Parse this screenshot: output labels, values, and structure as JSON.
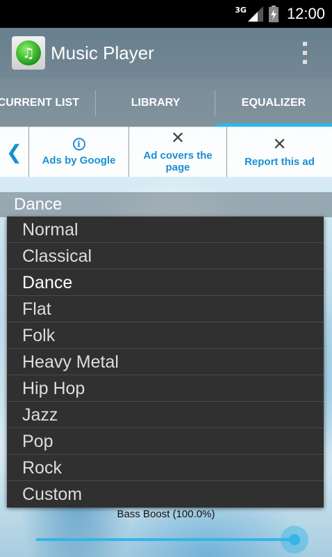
{
  "status_bar": {
    "network": "3G",
    "time": "12:00"
  },
  "action_bar": {
    "title": "Music Player",
    "icon": "music-note-icon"
  },
  "tabs": [
    {
      "label": "CURRENT LIST",
      "selected": false
    },
    {
      "label": "LIBRARY",
      "selected": false
    },
    {
      "label": "EQUALIZER",
      "selected": true
    }
  ],
  "ad_bar": {
    "ads_by_google": "Ads by Google",
    "ad_covers_line1": "Ad covers the",
    "ad_covers_line2": "page",
    "report_ad": "Report this ad"
  },
  "equalizer": {
    "current_preset": "Dance",
    "presets": [
      "Normal",
      "Classical",
      "Dance",
      "Flat",
      "Folk",
      "Heavy Metal",
      "Hip Hop",
      "Jazz",
      "Pop",
      "Rock",
      "Custom"
    ],
    "selected_index": 2,
    "bass_boost_label": "Bass Boost (100.0%)",
    "bass_boost_value": 1.0
  },
  "colors": {
    "accent": "#33b5e5",
    "ad_text": "#1a8fd0"
  }
}
